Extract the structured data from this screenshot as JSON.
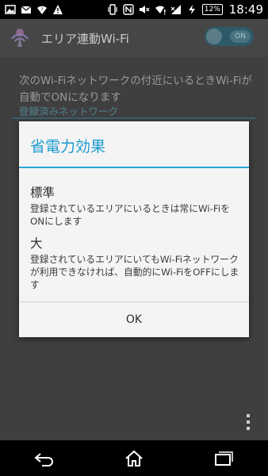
{
  "status_bar": {
    "left_icons": [
      "image-icon",
      "mail-icon",
      "wifi-question-icon",
      "warning-icon"
    ],
    "right_icons": [
      "vibrate-icon",
      "nfc-icon",
      "mute-icon",
      "wifi-alert-icon",
      "signal-icon",
      "charging-icon"
    ],
    "battery": "12%",
    "time": "18:49"
  },
  "app": {
    "title": "エリア連動Wi-Fi",
    "toggle_label": "ON",
    "description": "次のWi-Fiネットワークの付近にいるときWi-Fiが自動でONになります",
    "section_header": "登録済みネットワーク"
  },
  "dialog": {
    "title": "省電力効果",
    "options": [
      {
        "title": "標準",
        "description": "登録されているエリアにいるときは常にWi-FiをONにします"
      },
      {
        "title": "大",
        "description": "登録されているエリアにいてもWi-Fiネットワークが利用できなければ、自動的にWi-FiをOFFにします"
      }
    ],
    "ok_label": "OK"
  },
  "colors": {
    "accent": "#1c9ad0",
    "dialog_bg": "#f4f4f4"
  }
}
